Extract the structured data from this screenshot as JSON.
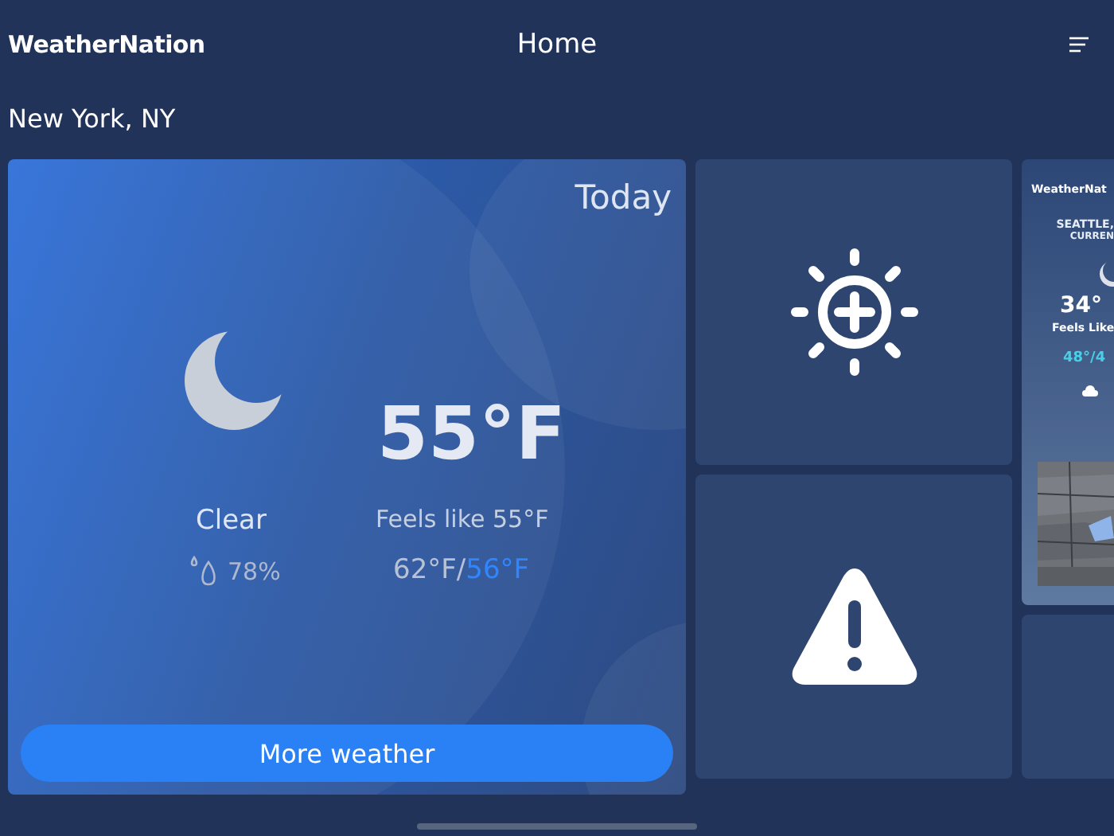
{
  "header": {
    "logo": "WeatherNation",
    "title": "Home"
  },
  "location": "New York, NY",
  "today": {
    "label": "Today",
    "condition": "Clear",
    "humidity": "78%",
    "temperature": "55°F",
    "feels_like": "Feels like 55°F",
    "high": "62°F/",
    "low": "56°F",
    "button": "More weather"
  },
  "tiles": [
    {
      "kind": "sun"
    },
    {
      "kind": "alert"
    }
  ],
  "preview": {
    "brand": "WeatherNat",
    "city": "SEATTLE,",
    "subtitle": "CURREN",
    "temperature": "34°",
    "feels_like": "Feels Like",
    "high": "48°/",
    "low": "4"
  }
}
